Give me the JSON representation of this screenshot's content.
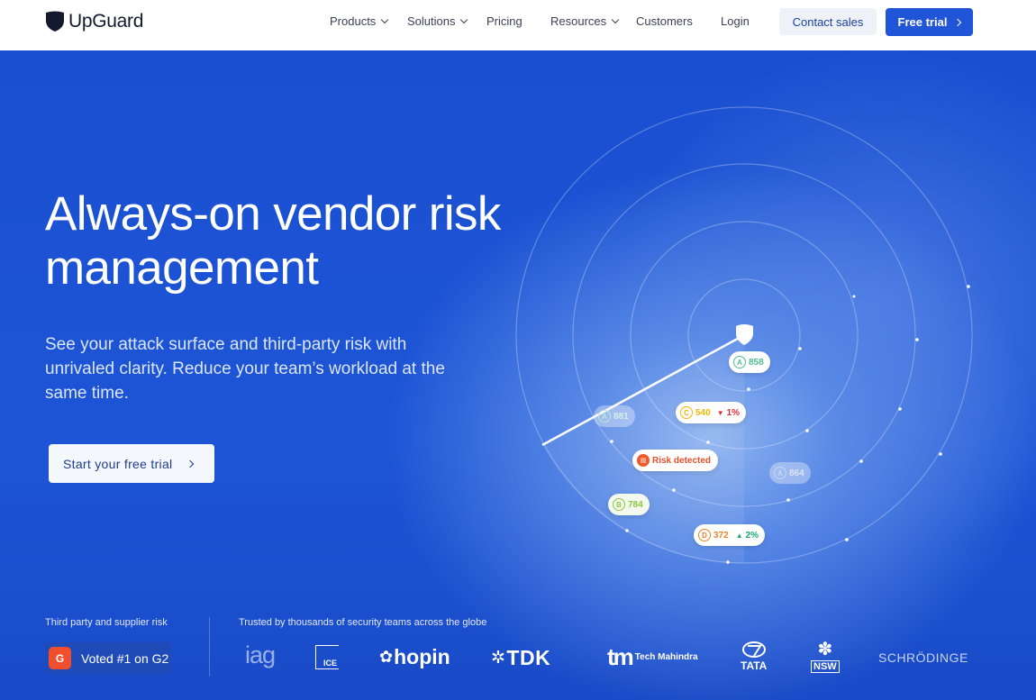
{
  "nav": {
    "brand": "UpGuard",
    "items": [
      {
        "label": "Products",
        "dropdown": true
      },
      {
        "label": "Solutions",
        "dropdown": true
      },
      {
        "label": "Pricing",
        "dropdown": false
      },
      {
        "label": "Resources",
        "dropdown": true
      },
      {
        "label": "Customers",
        "dropdown": false
      },
      {
        "label": "Login",
        "dropdown": false
      }
    ],
    "contact_label": "Contact sales",
    "trial_label": "Free trial"
  },
  "hero": {
    "title": "Always-on vendor risk management",
    "subtitle": "See your attack surface and third-party risk with unrivaled clarity. Reduce your team’s workload at the same time.",
    "cta_label": "Start your free trial"
  },
  "radar": {
    "pills": [
      {
        "grade": "A",
        "score": "858"
      },
      {
        "grade": "A",
        "score": "881"
      },
      {
        "grade": "C",
        "score": "540",
        "change": "1%",
        "direction": "down"
      },
      {
        "label": "Risk detected"
      },
      {
        "grade": "A",
        "score": "864"
      },
      {
        "grade": "B",
        "score": "784"
      },
      {
        "grade": "D",
        "score": "372",
        "change": "2%",
        "direction": "up"
      }
    ]
  },
  "trust": {
    "left_label": "Third party and supplier risk",
    "g2_label": "Voted #1 on G2",
    "right_label": "Trusted by thousands of security teams across the globe",
    "logos": [
      "iag",
      "ICE",
      "hopin",
      "TDK",
      "Tech Mahindra",
      "TATA",
      "NSW",
      "SCHRÖDINGER"
    ]
  },
  "colors": {
    "brand_blue": "#1f55d6",
    "hero_blue": "#1a4fd0",
    "grade_a": "#4cbf8f",
    "grade_b": "#8cc63f",
    "grade_c": "#f2b705",
    "grade_d": "#f0822a",
    "risk": "#ef5a2a"
  }
}
